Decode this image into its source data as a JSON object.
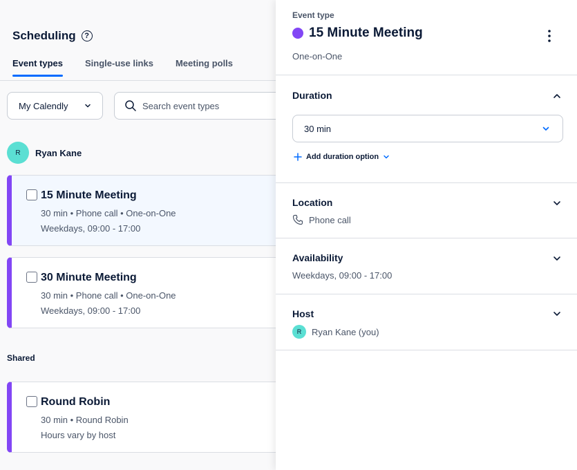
{
  "header": {
    "title": "Scheduling"
  },
  "tabs": [
    {
      "label": "Event types",
      "active": true
    },
    {
      "label": "Single-use links"
    },
    {
      "label": "Meeting polls"
    }
  ],
  "filters": {
    "calendar_select": "My Calendly",
    "search_placeholder": "Search event types"
  },
  "owner": {
    "initial": "R",
    "name": "Ryan Kane"
  },
  "event_types": [
    {
      "title": "15 Minute Meeting",
      "details": "30 min • Phone call • One-on-One",
      "hours": "Weekdays, 09:00 - 17:00",
      "selected": true
    },
    {
      "title": "30 Minute Meeting",
      "details": "30 min • Phone call • One-on-One",
      "hours": "Weekdays, 09:00 - 17:00"
    }
  ],
  "shared": {
    "label": "Shared",
    "items": [
      {
        "title": "Round Robin",
        "details": "30 min • Round Robin",
        "hours": "Hours vary by host"
      }
    ]
  },
  "detail": {
    "label": "Event type",
    "title": "15 Minute Meeting",
    "subtitle": "One-on-One",
    "color": "#8246f5",
    "duration": {
      "title": "Duration",
      "value": "30 min",
      "add_option": "Add duration option"
    },
    "location": {
      "title": "Location",
      "value": "Phone call"
    },
    "availability": {
      "title": "Availability",
      "value": "Weekdays, 09:00 - 17:00"
    },
    "host": {
      "title": "Host",
      "initial": "R",
      "value": "Ryan Kane (you)"
    }
  },
  "colors": {
    "accent": "#006bff",
    "event": "#8246f5",
    "avatar": "#5bdfd3"
  }
}
